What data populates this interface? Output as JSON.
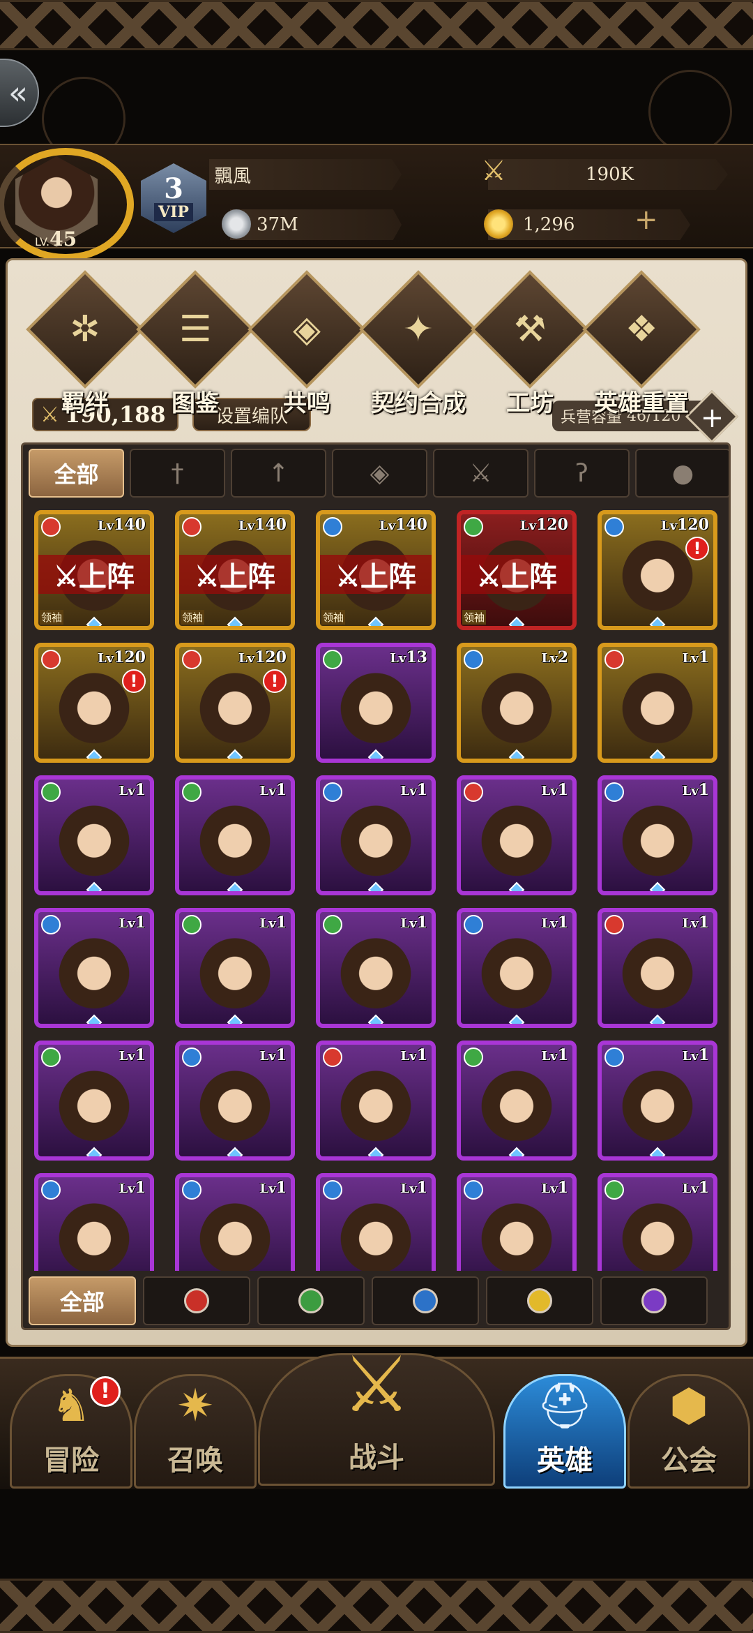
{
  "player": {
    "name": "飄風",
    "level_prefix": "LV.",
    "level": "45",
    "vip_level": "3",
    "vip_label": "VIP",
    "silver": "37M",
    "power_currency": "190K",
    "gold": "1,296"
  },
  "menu": [
    {
      "label": "羁绊",
      "icon": "bond-icon",
      "glyph": "✲"
    },
    {
      "label": "图鉴",
      "icon": "scroll-icon",
      "glyph": "☰"
    },
    {
      "label": "共鸣",
      "icon": "resonance-icon",
      "glyph": "◈"
    },
    {
      "label": "契约合成",
      "icon": "contract-icon",
      "glyph": "✦"
    },
    {
      "label": "工坊",
      "icon": "anvil-icon",
      "glyph": "⚒"
    },
    {
      "label": "英雄重置",
      "icon": "reset-icon",
      "glyph": "❖"
    }
  ],
  "team": {
    "power": "190,188",
    "set_formation": "设置编队",
    "capacity_label": "兵营容量",
    "capacity": "46/120"
  },
  "class_tabs": [
    {
      "label": "全部",
      "icon": "all"
    },
    {
      "label": "",
      "icon": "sword-icon",
      "glyph": "†"
    },
    {
      "label": "",
      "icon": "arrow-icon",
      "glyph": "↑"
    },
    {
      "label": "",
      "icon": "magic-icon",
      "glyph": "◈"
    },
    {
      "label": "",
      "icon": "cross-blades-icon",
      "glyph": "⚔"
    },
    {
      "label": "",
      "icon": "staff-icon",
      "glyph": "ʔ"
    },
    {
      "label": "",
      "icon": "shield-icon",
      "glyph": "●"
    }
  ],
  "heroes": [
    {
      "lv": "140",
      "element": "fire",
      "frame": "gold",
      "deployed": true,
      "leader": true
    },
    {
      "lv": "140",
      "element": "fire",
      "frame": "gold",
      "deployed": true,
      "leader": true
    },
    {
      "lv": "140",
      "element": "water",
      "frame": "gold",
      "deployed": true,
      "leader": true
    },
    {
      "lv": "120",
      "element": "nature",
      "frame": "red",
      "deployed": true,
      "leader": true
    },
    {
      "lv": "120",
      "element": "water",
      "frame": "gold",
      "alert": true
    },
    {
      "lv": "120",
      "element": "fire",
      "frame": "gold",
      "alert": true
    },
    {
      "lv": "120",
      "element": "fire",
      "frame": "gold",
      "alert": true
    },
    {
      "lv": "13",
      "element": "nature",
      "frame": "purple"
    },
    {
      "lv": "2",
      "element": "water",
      "frame": "gold"
    },
    {
      "lv": "1",
      "element": "fire",
      "frame": "gold"
    },
    {
      "lv": "1",
      "element": "nature",
      "frame": "purple"
    },
    {
      "lv": "1",
      "element": "nature",
      "frame": "purple"
    },
    {
      "lv": "1",
      "element": "water",
      "frame": "purple"
    },
    {
      "lv": "1",
      "element": "fire",
      "frame": "purple"
    },
    {
      "lv": "1",
      "element": "water",
      "frame": "purple"
    },
    {
      "lv": "1",
      "element": "water",
      "frame": "purple"
    },
    {
      "lv": "1",
      "element": "nature",
      "frame": "purple"
    },
    {
      "lv": "1",
      "element": "nature",
      "frame": "purple"
    },
    {
      "lv": "1",
      "element": "water",
      "frame": "purple"
    },
    {
      "lv": "1",
      "element": "fire",
      "frame": "purple"
    },
    {
      "lv": "1",
      "element": "nature",
      "frame": "purple"
    },
    {
      "lv": "1",
      "element": "water",
      "frame": "purple"
    },
    {
      "lv": "1",
      "element": "fire",
      "frame": "purple"
    },
    {
      "lv": "1",
      "element": "nature",
      "frame": "purple"
    },
    {
      "lv": "1",
      "element": "water",
      "frame": "purple"
    },
    {
      "lv": "1",
      "element": "water",
      "frame": "purple"
    },
    {
      "lv": "1",
      "element": "water",
      "frame": "purple"
    },
    {
      "lv": "1",
      "element": "water",
      "frame": "purple"
    },
    {
      "lv": "1",
      "element": "water",
      "frame": "purple"
    },
    {
      "lv": "1",
      "element": "nature",
      "frame": "purple"
    }
  ],
  "hero_labels": {
    "lv_prefix": "Lv",
    "deployed": "⚔上阵",
    "leader": "领袖",
    "alert": "!"
  },
  "element_filters": [
    {
      "label": "全部"
    },
    {
      "icon": "fire-element-icon",
      "element": "fire"
    },
    {
      "icon": "nature-element-icon",
      "element": "nature"
    },
    {
      "icon": "water-element-icon",
      "element": "water"
    },
    {
      "icon": "light-element-icon",
      "element": "light"
    },
    {
      "icon": "dark-element-icon",
      "element": "dark"
    }
  ],
  "nav": [
    {
      "label": "冒险",
      "icon": "knight-icon",
      "glyph": "♞",
      "badge": "!"
    },
    {
      "label": "召唤",
      "icon": "summon-icon",
      "glyph": "✷"
    },
    {
      "label": "战斗",
      "icon": "battle-axes-icon",
      "glyph": "⚔"
    },
    {
      "label": "英雄",
      "icon": "helmet-icon",
      "glyph": "⛑",
      "active": true
    },
    {
      "label": "公会",
      "icon": "guild-icon",
      "glyph": "⬢"
    }
  ],
  "colors": {
    "accent_gold": "#d89a1c",
    "purple_frame": "#a936d6",
    "active_tab": "#2c8bd8"
  }
}
